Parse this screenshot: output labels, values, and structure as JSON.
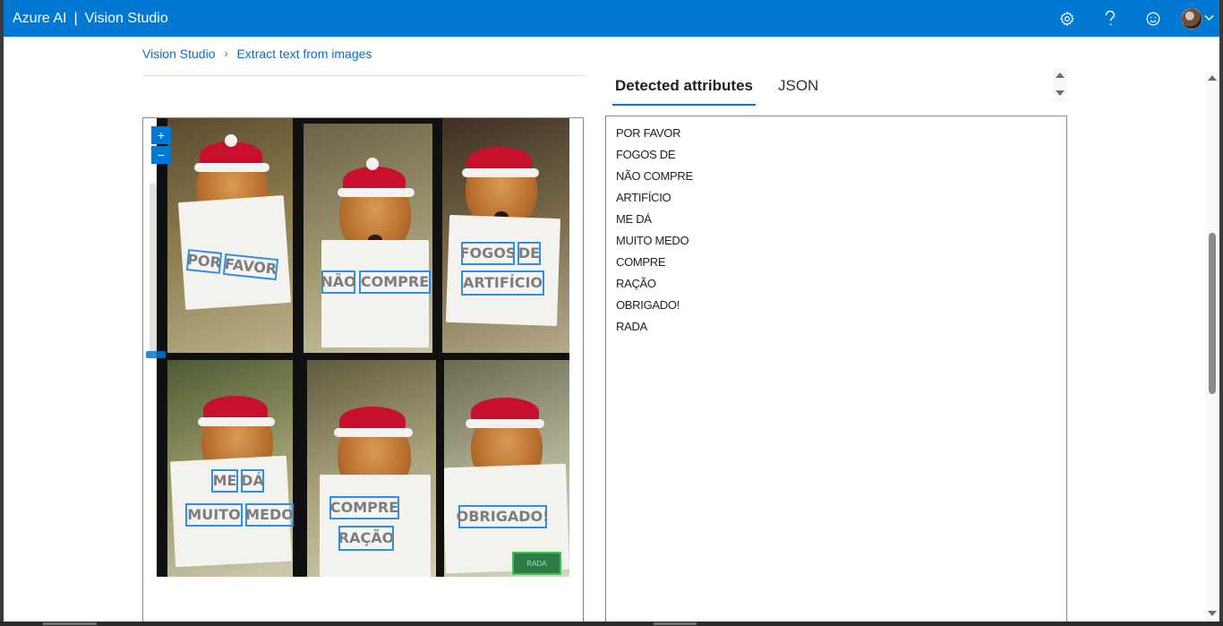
{
  "header": {
    "brand": "Azure AI",
    "separator": "|",
    "product": "Vision Studio",
    "icons": [
      "settings-icon",
      "help-icon",
      "feedback-icon",
      "avatar"
    ]
  },
  "breadcrumb": {
    "home": "Vision Studio",
    "separator": "›",
    "current": "Extract text from images"
  },
  "tabs": [
    {
      "label": "Detected attributes",
      "active": true
    },
    {
      "label": "JSON",
      "active": false
    }
  ],
  "zoom": {
    "in": "+",
    "out": "−"
  },
  "image": {
    "ocr_words": [
      "POR",
      "FAVOR",
      "NÃO",
      "COMPRE",
      "FOGOS",
      "DE",
      "ARTIFÍCIO",
      "ME",
      "DÁ",
      "MUITO",
      "MEDO",
      "COMPRE",
      "RAÇÃO",
      "OBRIGADO!"
    ],
    "watermark": "RADA"
  },
  "attributes": [
    "POR FAVOR",
    "FOGOS DE",
    "NÃO COMPRE",
    "ARTIFÍCIO",
    "ME DÁ",
    "MUITO MEDO",
    "COMPRE",
    "RAÇÃO",
    "OBRIGADO!",
    "RADA"
  ],
  "colors": {
    "accent": "#0078d4",
    "ocr_box": "#2f8fe8",
    "watermark_box": "#3cc34a"
  }
}
